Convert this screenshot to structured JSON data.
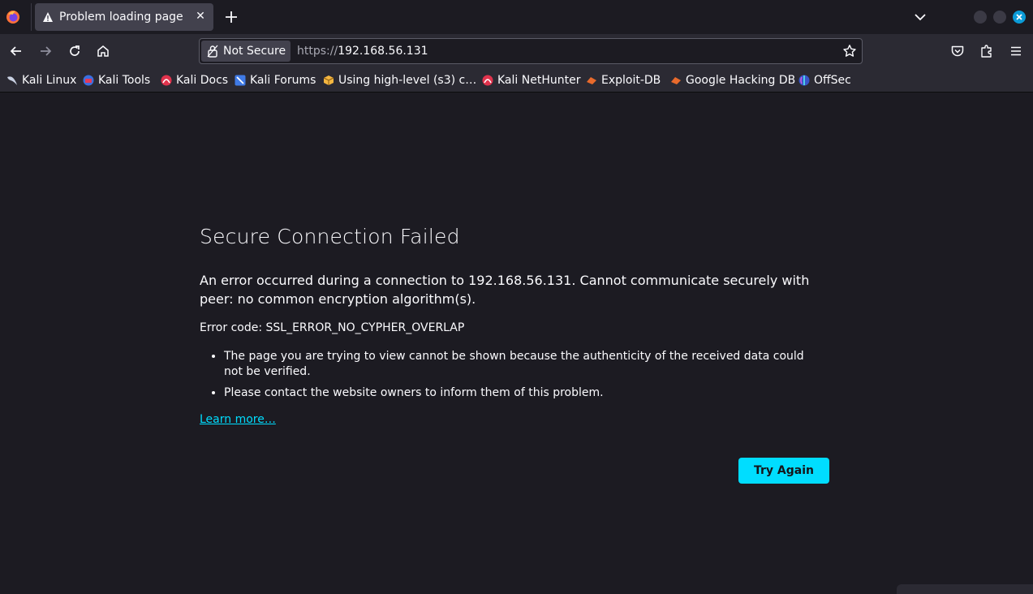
{
  "tab": {
    "title": "Problem loading page",
    "close_glyph": "✕"
  },
  "urlbar": {
    "security_label": "Not Secure",
    "url_scheme": "https://",
    "url_host": "192.168.56.131"
  },
  "bookmarks": [
    {
      "label": "Kali Linux",
      "icon": "kali-dragon-icon"
    },
    {
      "label": "Kali Tools",
      "icon": "kali-tools-icon"
    },
    {
      "label": "Kali Docs",
      "icon": "kali-docs-icon"
    },
    {
      "label": "Kali Forums",
      "icon": "kali-forums-icon"
    },
    {
      "label": "Using high-level (s3) c…",
      "icon": "aws-box-icon"
    },
    {
      "label": "Kali NetHunter",
      "icon": "kali-nethunter-icon"
    },
    {
      "label": "Exploit-DB",
      "icon": "exploit-db-icon"
    },
    {
      "label": "Google Hacking DB",
      "icon": "ghdb-icon"
    },
    {
      "label": "OffSec",
      "icon": "offsec-icon"
    }
  ],
  "error": {
    "title": "Secure Connection Failed",
    "description": "An error occurred during a connection to 192.168.56.131. Cannot communicate securely with peer: no common encryption algorithm(s).",
    "code_line": "Error code: SSL_ERROR_NO_CYPHER_OVERLAP",
    "bullets": [
      "The page you are trying to view cannot be shown because the authenticity of the received data could not be verified.",
      "Please contact the website owners to inform them of this problem."
    ],
    "learn_more": "Learn more…",
    "try_again": "Try Again"
  },
  "colors": {
    "accent": "#00ddff",
    "page_bg": "#1c1b22",
    "toolbar_bg": "#2b2a33"
  }
}
